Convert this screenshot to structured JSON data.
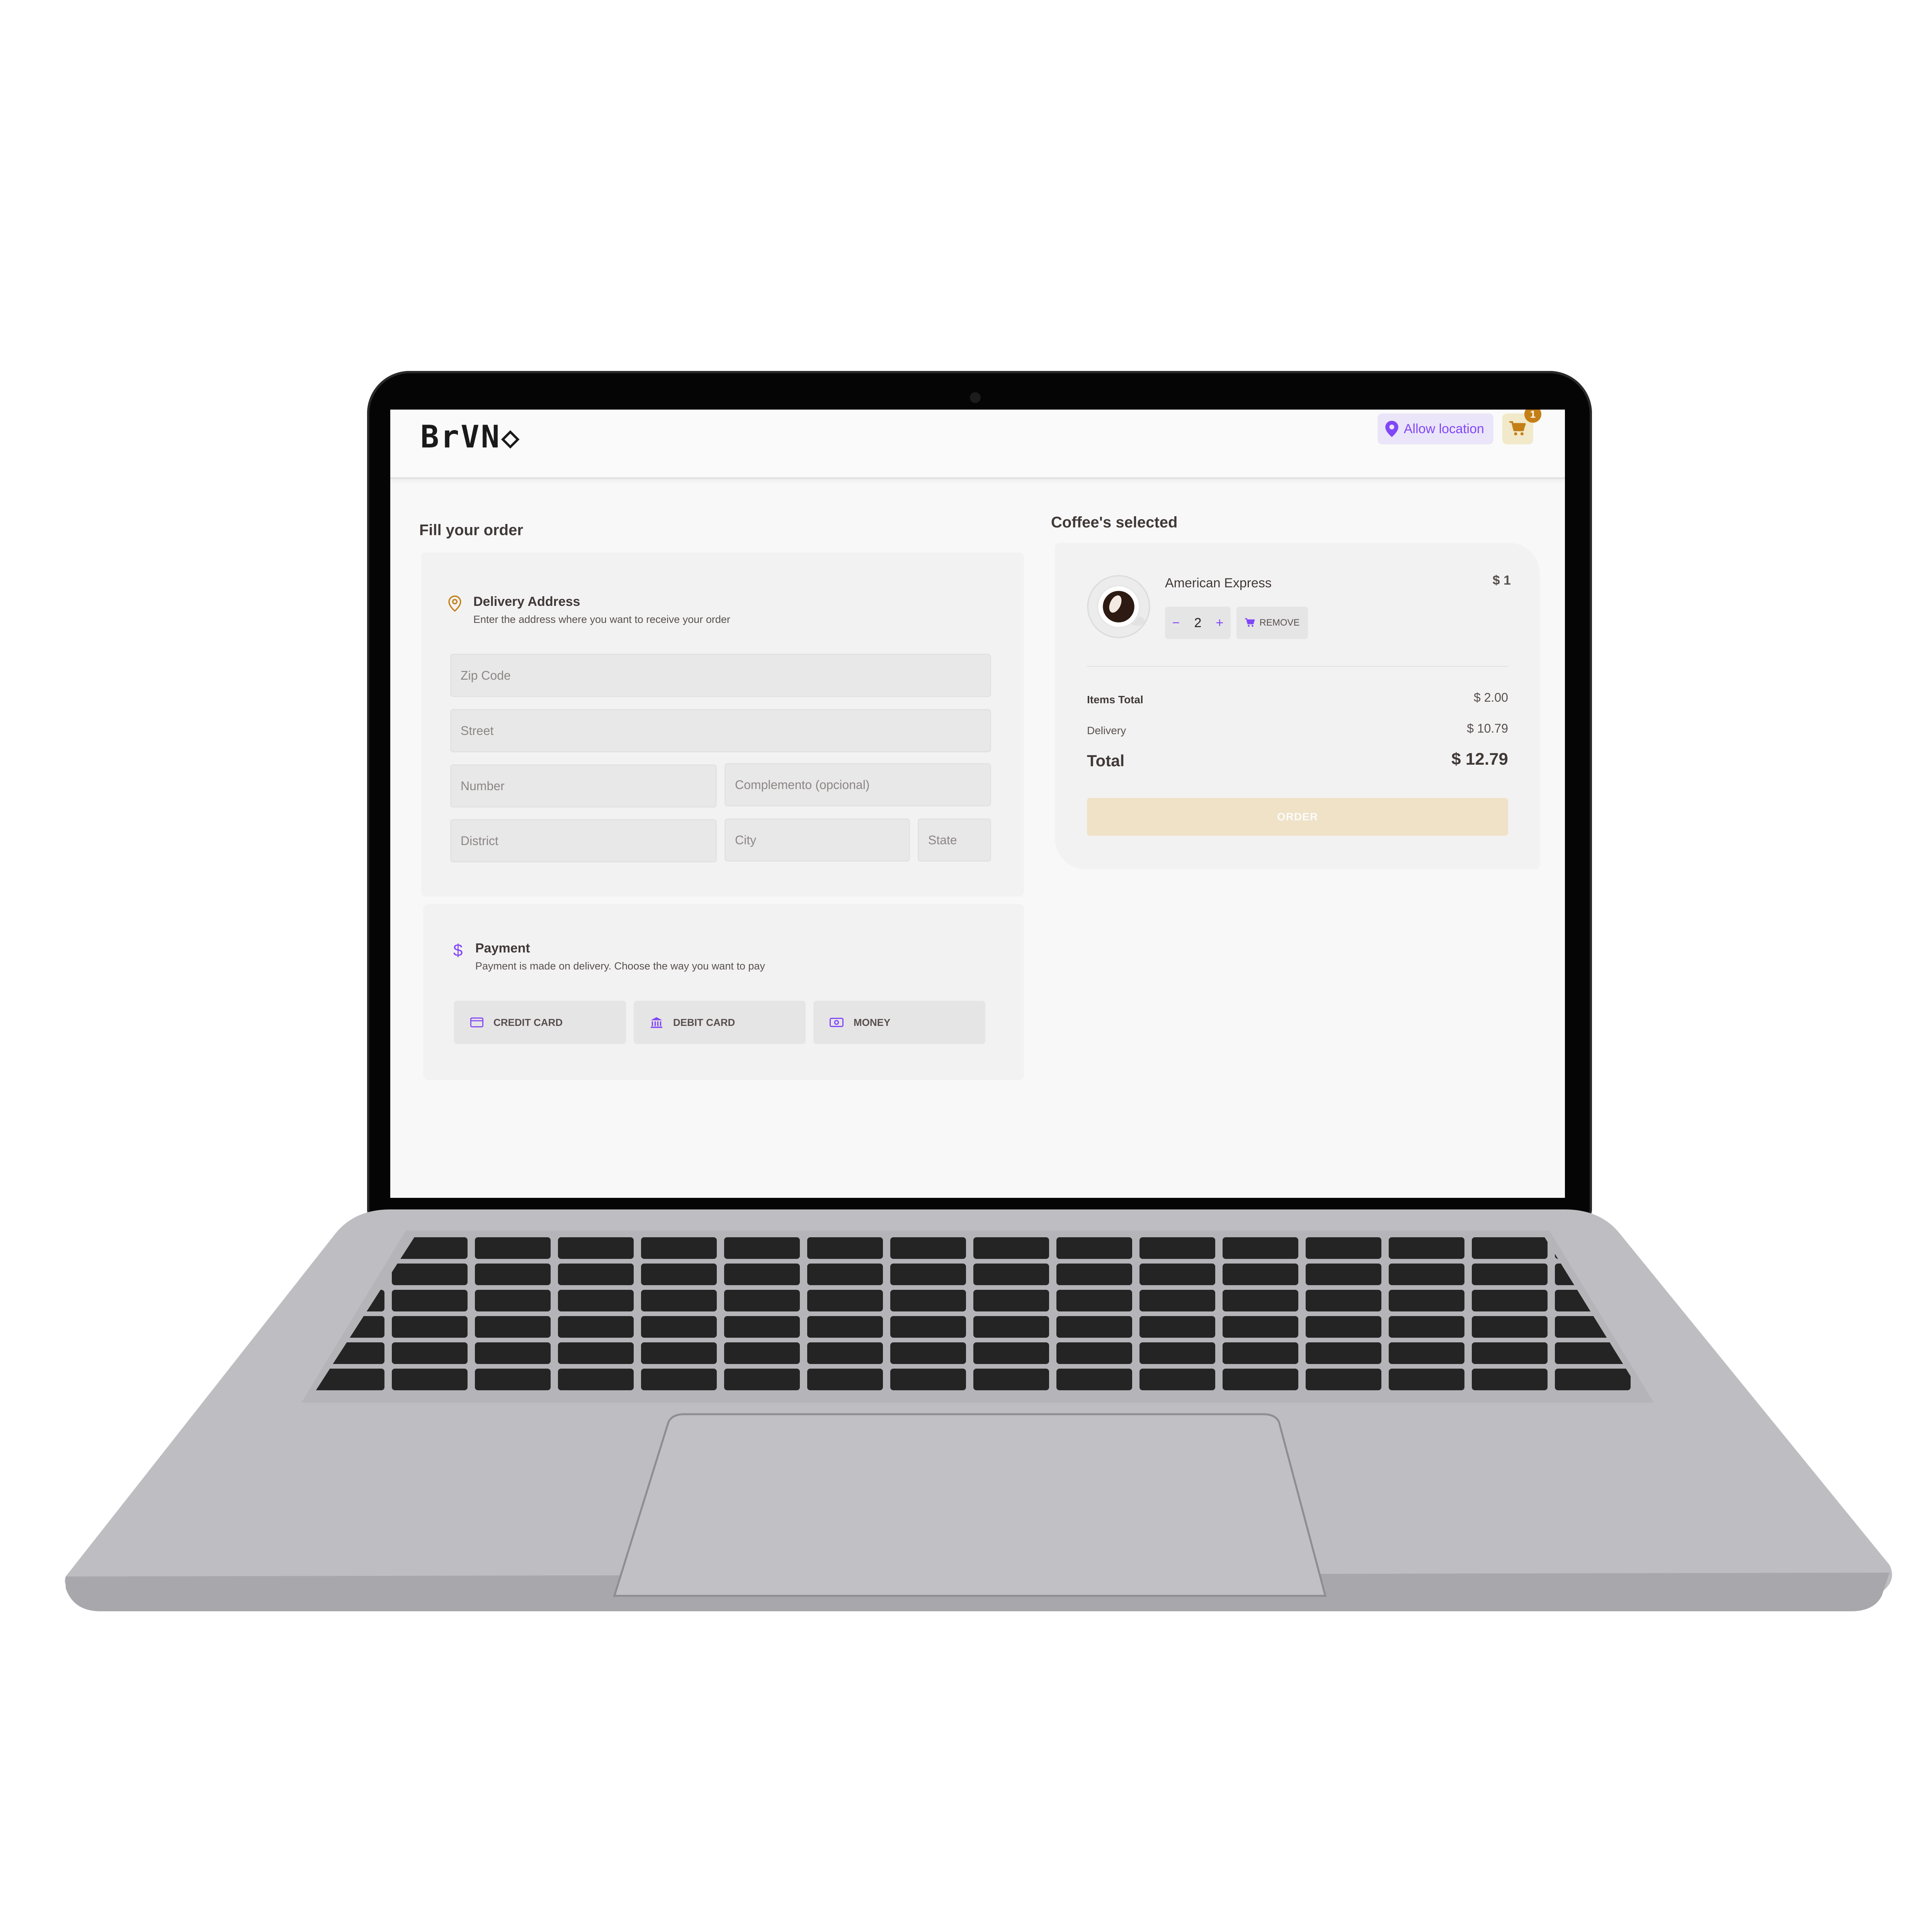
{
  "header": {
    "logo_text": "BrVN◇",
    "location_label": "Allow location",
    "cart_count": "1"
  },
  "checkout": {
    "title": "Fill your order",
    "address": {
      "title": "Delivery Address",
      "subtitle": "Enter the address where you want to receive your order",
      "placeholders": {
        "zip": "Zip Code",
        "street": "Street",
        "number": "Number",
        "complement": "Complemento (opcional)",
        "district": "District",
        "city": "City",
        "state": "State"
      }
    },
    "payment": {
      "title": "Payment",
      "subtitle": "Payment is made on delivery. Choose the way you want to pay",
      "options": [
        "CREDIT CARD",
        "DEBIT CARD",
        "MONEY"
      ]
    }
  },
  "cart": {
    "title": "Coffee's selected",
    "item": {
      "name": "American Express",
      "price": "$ 1",
      "quantity": "2",
      "minus": "−",
      "plus": "+",
      "remove_label": "REMOVE"
    },
    "summary": {
      "items_total_label": "Items Total",
      "items_total_value": "$ 2.00",
      "delivery_label": "Delivery",
      "delivery_value": "$ 10.79",
      "total_label": "Total",
      "total_value": "$ 12.79"
    },
    "order_label": "ORDER"
  },
  "colors": {
    "purple": "#8047f8",
    "yellow_dark": "#c47f17",
    "yellow_light": "#f1e9c9",
    "card_bg": "#f3f2f2"
  }
}
